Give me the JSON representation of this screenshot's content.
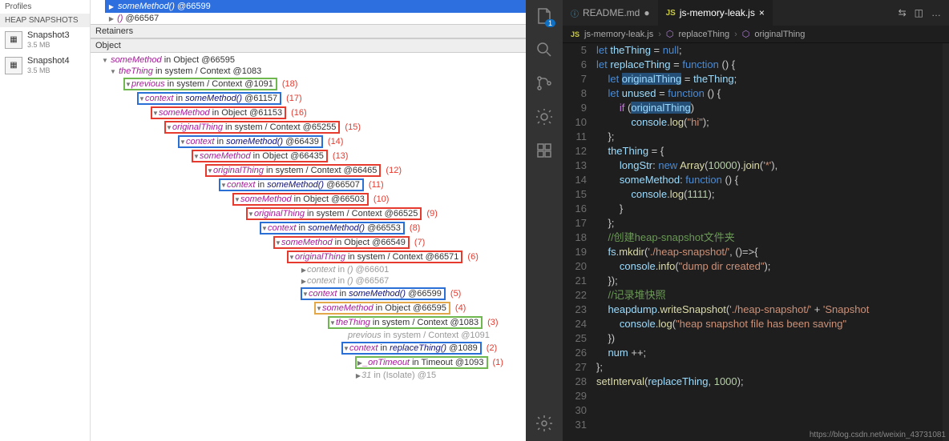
{
  "devtools": {
    "profiles_label": "Profiles",
    "heap_label": "HEAP SNAPSHOTS",
    "snapshots": [
      {
        "name": "Snapshot3",
        "size": "3.5 MB"
      },
      {
        "name": "Snapshot4",
        "size": "3.5 MB"
      }
    ],
    "retainers_label": "Retainers",
    "object_label": "Object",
    "selected_row": {
      "method": "someMethod()",
      "id": "@66599"
    },
    "other_row": {
      "paren": "()",
      "id": "@66567"
    },
    "root": {
      "method": "someMethod",
      "in": "in Object",
      "id": "@66595"
    },
    "theThing": {
      "name": "theThing",
      "ctx": "in system / Context",
      "id": "@1083"
    },
    "rows": [
      {
        "indent": 1,
        "box": "green",
        "arrow": "d",
        "name": "previous",
        "ctx": "in system / Context",
        "id": "@1091",
        "anno": "(18)"
      },
      {
        "indent": 2,
        "box": "blue",
        "arrow": "d",
        "name": "context",
        "ctx": "in",
        "ital": "someMethod()",
        "id": "@61157",
        "anno": "(17)"
      },
      {
        "indent": 3,
        "box": "red",
        "arrow": "d",
        "name": "someMethod",
        "ctx": "in Object",
        "id": "@61153",
        "anno": "(16)"
      },
      {
        "indent": 4,
        "box": "red",
        "arrow": "d",
        "name": "originalThing",
        "ctx": "in system / Context",
        "id": "@65255",
        "anno": "(15)"
      },
      {
        "indent": 5,
        "box": "blue",
        "arrow": "d",
        "name": "context",
        "ctx": "in",
        "ital": "someMethod()",
        "id": "@66439",
        "anno": "(14)"
      },
      {
        "indent": 6,
        "box": "red",
        "arrow": "d",
        "name": "someMethod",
        "ctx": "in Object",
        "id": "@66435",
        "anno": "(13)"
      },
      {
        "indent": 7,
        "box": "red",
        "arrow": "d",
        "name": "originalThing",
        "ctx": "in system / Context",
        "id": "@66465",
        "anno": "(12)"
      },
      {
        "indent": 8,
        "box": "blue",
        "arrow": "d",
        "name": "context",
        "ctx": "in",
        "ital": "someMethod()",
        "id": "@66507",
        "anno": "(11)"
      },
      {
        "indent": 9,
        "box": "red",
        "arrow": "d",
        "name": "someMethod",
        "ctx": "in Object",
        "id": "@66503",
        "anno": "(10)"
      },
      {
        "indent": 10,
        "box": "red",
        "arrow": "d",
        "name": "originalThing",
        "ctx": "in system / Context",
        "id": "@66525",
        "anno": "(9)"
      },
      {
        "indent": 11,
        "box": "blue",
        "arrow": "d",
        "name": "context",
        "ctx": "in",
        "ital": "someMethod()",
        "id": "@66553",
        "anno": "(8)"
      },
      {
        "indent": 12,
        "box": "red",
        "arrow": "d",
        "name": "someMethod",
        "ctx": "in Object",
        "id": "@66549",
        "anno": "(7)"
      },
      {
        "indent": 13,
        "box": "red",
        "arrow": "d",
        "name": "originalThing",
        "ctx": "in system / Context",
        "id": "@66571",
        "anno": "(6)"
      },
      {
        "indent": 14,
        "box": "",
        "arrow": "r",
        "name": "context",
        "ctx": "in",
        "ital": "()",
        "id": "@66601",
        "anno": ""
      },
      {
        "indent": 14,
        "box": "",
        "arrow": "r",
        "name": "context",
        "ctx": "in",
        "ital": "()",
        "id": "@66567",
        "anno": ""
      },
      {
        "indent": 14,
        "box": "blue",
        "arrow": "d",
        "name": "context",
        "ctx": "in",
        "ital": "someMethod()",
        "id": "@66599",
        "anno": "(5)"
      },
      {
        "indent": 15,
        "box": "orange",
        "arrow": "d",
        "name": "someMethod",
        "ctx": "in Object",
        "id": "@66595",
        "anno": "(4)"
      },
      {
        "indent": 16,
        "box": "green",
        "arrow": "d",
        "name": "theThing",
        "ctx": "in system / Context",
        "id": "@1083",
        "anno": "(3)"
      },
      {
        "indent": 17,
        "box": "",
        "arrow": "",
        "name": "previous",
        "ctx": "in system / Context",
        "id": "@1091",
        "anno": ""
      },
      {
        "indent": 17,
        "box": "blue",
        "arrow": "d",
        "name": "context",
        "ctx": "in",
        "ital": "replaceThing()",
        "id": "@1089",
        "anno": "(2)"
      },
      {
        "indent": 18,
        "box": "green",
        "arrow": "r",
        "name": "_onTimeout",
        "ctx": "in Timeout",
        "id": "@1093",
        "anno": "(1)"
      },
      {
        "indent": 18,
        "box": "",
        "arrow": "r",
        "name": "31",
        "ctx": "in (Isolate)",
        "id": "@15",
        "anno": ""
      }
    ]
  },
  "vscode": {
    "tabs": [
      {
        "icon": "ⓘ",
        "label": "README.md",
        "dirty": "●"
      },
      {
        "icon": "JS",
        "label": "js-memory-leak.js",
        "close": "×"
      }
    ],
    "tab_icons": {
      "split": "⫞",
      "more": "…"
    },
    "crumbs": [
      "js-memory-leak.js",
      "replaceThing",
      "originalThing"
    ],
    "crumb_icon_js": "JS",
    "crumb_icon_cube": "⬡",
    "badge": "1",
    "lines": [
      5,
      6,
      7,
      8,
      9,
      10,
      11,
      12,
      13,
      14,
      15,
      16,
      17,
      18,
      19,
      20,
      21,
      22,
      23,
      24,
      25,
      26,
      27,
      28,
      29,
      30,
      31
    ],
    "code": {
      "5": {
        "tokens": [
          [
            "kw",
            "let "
          ],
          [
            "var",
            "theThing"
          ],
          [
            "op",
            " = "
          ],
          [
            "kw",
            "null"
          ],
          [
            "op",
            ";"
          ]
        ]
      },
      "6": {
        "tokens": [
          [
            "kw",
            "let "
          ],
          [
            "var",
            "replaceThing"
          ],
          [
            "op",
            " = "
          ],
          [
            "kw",
            "function"
          ],
          [
            "op",
            " () {"
          ]
        ]
      },
      "7": {
        "tokens": [
          [
            "op",
            "    "
          ],
          [
            "kw",
            "let "
          ],
          [
            "hl",
            "originalThing"
          ],
          [
            "op",
            " = "
          ],
          [
            "var",
            "theThing"
          ],
          [
            "op",
            ";"
          ]
        ]
      },
      "8": {
        "tokens": [
          [
            "op",
            "    "
          ],
          [
            "kw",
            "let "
          ],
          [
            "var",
            "unused"
          ],
          [
            "op",
            " = "
          ],
          [
            "kw",
            "function"
          ],
          [
            "op",
            " () {"
          ]
        ]
      },
      "9": {
        "tokens": [
          [
            "op",
            "        "
          ],
          [
            "kw2",
            "if"
          ],
          [
            "op",
            " ("
          ],
          [
            "hl",
            "originalThing"
          ],
          [
            "op",
            ")"
          ]
        ]
      },
      "10": {
        "tokens": [
          [
            "op",
            "            "
          ],
          [
            "var",
            "console"
          ],
          [
            "op",
            "."
          ],
          [
            "fn",
            "log"
          ],
          [
            "op",
            "("
          ],
          [
            "str",
            "\"hi\""
          ],
          [
            "op",
            ");"
          ]
        ]
      },
      "11": {
        "tokens": [
          [
            "op",
            "    };"
          ]
        ]
      },
      "12": {
        "tokens": [
          [
            "op",
            "    "
          ],
          [
            "var",
            "theThing"
          ],
          [
            "op",
            " = {"
          ]
        ]
      },
      "13": {
        "tokens": [
          [
            "op",
            "        "
          ],
          [
            "var",
            "longStr"
          ],
          [
            "op",
            ": "
          ],
          [
            "kw",
            "new"
          ],
          [
            "op",
            " "
          ],
          [
            "fn",
            "Array"
          ],
          [
            "op",
            "("
          ],
          [
            "num",
            "10000"
          ],
          [
            "op",
            ")."
          ],
          [
            "fn",
            "join"
          ],
          [
            "op",
            "("
          ],
          [
            "str",
            "'*'"
          ],
          [
            "op",
            "),"
          ]
        ]
      },
      "14": {
        "tokens": [
          [
            "op",
            "        "
          ],
          [
            "var",
            "someMethod"
          ],
          [
            "op",
            ": "
          ],
          [
            "kw",
            "function"
          ],
          [
            "op",
            " () {"
          ]
        ]
      },
      "15": {
        "tokens": [
          [
            "op",
            "            "
          ],
          [
            "var",
            "console"
          ],
          [
            "op",
            "."
          ],
          [
            "fn",
            "log"
          ],
          [
            "op",
            "("
          ],
          [
            "num",
            "1111"
          ],
          [
            "op",
            ");"
          ]
        ]
      },
      "16": {
        "tokens": [
          [
            "op",
            "        }"
          ]
        ]
      },
      "17": {
        "tokens": [
          [
            "op",
            "    };"
          ]
        ]
      },
      "18": {
        "tokens": [
          [
            "op",
            ""
          ]
        ]
      },
      "19": {
        "tokens": [
          [
            "op",
            "    "
          ],
          [
            "cmt",
            "//创建heap-snapshot文件夹"
          ]
        ]
      },
      "20": {
        "tokens": [
          [
            "op",
            "    "
          ],
          [
            "var",
            "fs"
          ],
          [
            "op",
            "."
          ],
          [
            "fn",
            "mkdir"
          ],
          [
            "op",
            "("
          ],
          [
            "str",
            "'./heap-snapshot/'"
          ],
          [
            "op",
            ", ()=>{"
          ]
        ]
      },
      "21": {
        "tokens": [
          [
            "op",
            "        "
          ],
          [
            "var",
            "console"
          ],
          [
            "op",
            "."
          ],
          [
            "fn",
            "info"
          ],
          [
            "op",
            "("
          ],
          [
            "str",
            "\"dump dir created\""
          ],
          [
            "op",
            ");"
          ]
        ]
      },
      "22": {
        "tokens": [
          [
            "op",
            "    });"
          ]
        ]
      },
      "23": {
        "tokens": [
          [
            "op",
            ""
          ]
        ]
      },
      "24": {
        "tokens": [
          [
            "op",
            "    "
          ],
          [
            "cmt",
            "//记录堆快照"
          ]
        ]
      },
      "25": {
        "tokens": [
          [
            "op",
            "    "
          ],
          [
            "var",
            "heapdump"
          ],
          [
            "op",
            "."
          ],
          [
            "fn",
            "writeSnapshot"
          ],
          [
            "op",
            "("
          ],
          [
            "str",
            "'./heap-snapshot/'"
          ],
          [
            "op",
            " + "
          ],
          [
            "str",
            "'Snapshot"
          ]
        ]
      },
      "26": {
        "tokens": [
          [
            "op",
            "        "
          ],
          [
            "var",
            "console"
          ],
          [
            "op",
            "."
          ],
          [
            "fn",
            "log"
          ],
          [
            "op",
            "("
          ],
          [
            "str",
            "\"heap snapshot file has been saving\""
          ]
        ]
      },
      "27": {
        "tokens": [
          [
            "op",
            "    })"
          ]
        ]
      },
      "28": {
        "tokens": [
          [
            "op",
            "    "
          ],
          [
            "var",
            "num"
          ],
          [
            "op",
            " ++;"
          ]
        ]
      },
      "29": {
        "tokens": [
          [
            "op",
            "};"
          ]
        ]
      },
      "30": {
        "tokens": [
          [
            "op",
            ""
          ]
        ]
      },
      "31": {
        "tokens": [
          [
            "fn",
            "setInterval"
          ],
          [
            "op",
            "("
          ],
          [
            "var",
            "replaceThing"
          ],
          [
            "op",
            ", "
          ],
          [
            "num",
            "1000"
          ],
          [
            "op",
            ");"
          ]
        ]
      }
    },
    "watermark": "https://blog.csdn.net/weixin_43731081"
  }
}
